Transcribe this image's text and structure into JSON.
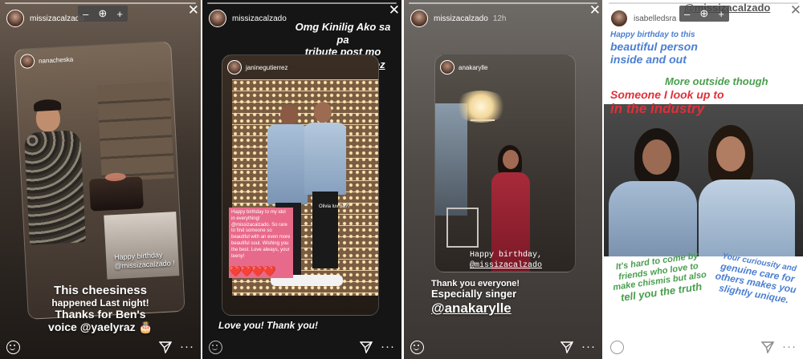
{
  "zoom_controls": {
    "minus": "–",
    "zoom_icon": "⊕",
    "plus": "+"
  },
  "stories": [
    {
      "username": "missizacalzado",
      "time": "",
      "repost_username": "nanacheska",
      "sticker_text": "Happy birthday\n@missizacalzado !",
      "caption": [
        "This cheesiness",
        "happened Last night!",
        "Thanks for Ben's",
        "voice @yaelyraz 🎂"
      ]
    },
    {
      "username": "missizacalzado",
      "time": "",
      "headline": [
        "Omg Kinilig Ako sa pa",
        "tribute post mo",
        "@janinegutierrez"
      ],
      "repost_username": "janinegutierrez",
      "birthday_note": "Happy birthday to my idol in everything! @missizacalzado. So rare to find someone so beautiful with an even more beautiful soul. Wishing you the best. Love always, your teeny!",
      "olivia_text": "Olivia luv ba??",
      "hearts": "❤️❤️❤️❤️",
      "caption": "Love you! Thank you!"
    },
    {
      "username": "missizacalzado",
      "time": "12h",
      "repost_username": "anakarylle",
      "greeting": [
        "Happy birthday,",
        "@missizacalzado"
      ],
      "caption": [
        "Thank you everyone!",
        "Especially singer"
      ],
      "mention": "@anakarylle"
    },
    {
      "username": "isabelledsra",
      "time": "",
      "overlay_mention": "@missizacalzado",
      "text1": [
        "Happy birthday to this",
        "beautiful person",
        "inside and out"
      ],
      "text2": "More outside though",
      "text3": [
        "Someone I look up to",
        "in the industry"
      ],
      "text4": [
        "It's hard to come by",
        "friends who love to",
        "make chismis but also",
        "tell you the truth"
      ],
      "text5": [
        "Your curiousity and",
        "genuine care for",
        "others makes you",
        "slightly unique."
      ]
    }
  ],
  "colors": {
    "green_text": "#4a9e4e",
    "red_text": "#e0303a",
    "blue_text": "#4b7fd1",
    "pink_sticker": "#e86a8a"
  }
}
